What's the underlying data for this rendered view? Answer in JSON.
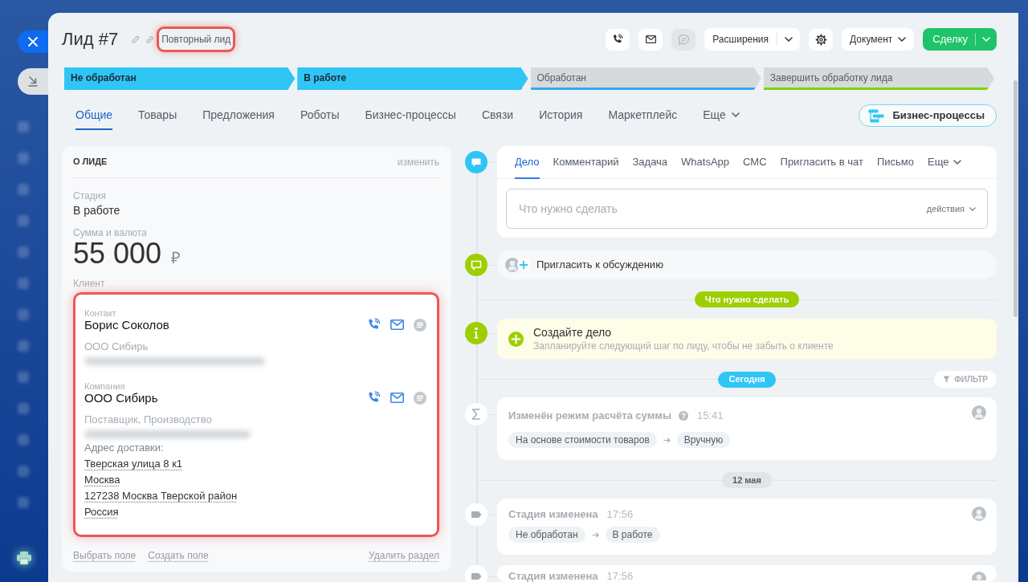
{
  "header": {
    "title": "Лид #7",
    "tag": {
      "label": "Повторный лид",
      "highlighted": true
    },
    "toolbar": [
      {
        "kind": "icon",
        "disabled": false
      },
      {
        "kind": "icon",
        "disabled": false
      },
      {
        "kind": "icon",
        "disabled": true
      },
      {
        "kind": "split",
        "label": "Расширения"
      },
      {
        "kind": "icon",
        "disabled": false
      },
      {
        "kind": "dropdown",
        "label": "Документ"
      },
      {
        "kind": "primary",
        "label": "Сделку"
      }
    ]
  },
  "stages": [
    {
      "label": "Не обработан",
      "reached": true,
      "color": "#2fc6f6"
    },
    {
      "label": "В работе",
      "reached": true,
      "color": "#2fc6f6"
    },
    {
      "label": "Обработан",
      "reached": false,
      "color": "#39a8ef"
    },
    {
      "label": "Завершить обработку лида",
      "reached": false,
      "color": "#7bd500"
    }
  ],
  "tabs": [
    {
      "label": "Общие",
      "selected": true,
      "dropdown": false
    },
    {
      "label": "Товары",
      "selected": false,
      "dropdown": false
    },
    {
      "label": "Предложения",
      "selected": false,
      "dropdown": false
    },
    {
      "label": "Роботы",
      "selected": false,
      "dropdown": false
    },
    {
      "label": "Бизнес-процессы",
      "selected": false,
      "dropdown": false
    },
    {
      "label": "Связи",
      "selected": false,
      "dropdown": false
    },
    {
      "label": "История",
      "selected": false,
      "dropdown": false
    },
    {
      "label": "Маркетплейс",
      "selected": false,
      "dropdown": false
    },
    {
      "label": "Еще",
      "selected": false,
      "dropdown": true
    }
  ],
  "process_button": {
    "label": "Бизнес-процессы"
  },
  "about": {
    "title": "О ЛИДЕ",
    "edit": "изменить",
    "fields": [
      {
        "kind": "text",
        "label": "Стадия",
        "value": "В работе"
      },
      {
        "kind": "money",
        "label": "Сумма и валюта",
        "value": "55 000",
        "currency": "₽"
      }
    ],
    "client": {
      "label": "Клиент",
      "highlighted": true,
      "entries": [
        {
          "type": "Контакт",
          "name": "Борис Соколов",
          "lines": [
            {
              "kind": "muted",
              "text": "ООО Сибирь"
            },
            {
              "kind": "redacted"
            }
          ]
        },
        {
          "type": "Компания",
          "name": "ООО Сибирь",
          "lines": [
            {
              "kind": "muted",
              "text": "Поставщик, Производство"
            },
            {
              "kind": "redacted"
            },
            {
              "kind": "label",
              "text": "Адрес доставки:"
            },
            {
              "kind": "address",
              "text": "Тверская улица 8 к1"
            },
            {
              "kind": "address",
              "text": "Москва"
            },
            {
              "kind": "address",
              "text": "127238 Москва Тверской район"
            },
            {
              "kind": "address",
              "text": "Россия"
            }
          ]
        }
      ]
    },
    "links": [
      "Выбрать поле",
      "Создать поле"
    ],
    "delete": "Удалить раздел"
  },
  "composer": {
    "tabs": [
      {
        "label": "Дело",
        "selected": true,
        "dropdown": false
      },
      {
        "label": "Комментарий",
        "selected": false,
        "dropdown": false
      },
      {
        "label": "Задача",
        "selected": false,
        "dropdown": false
      },
      {
        "label": "WhatsApp",
        "selected": false,
        "dropdown": false
      },
      {
        "label": "СМС",
        "selected": false,
        "dropdown": false
      },
      {
        "label": "Пригласить в чат",
        "selected": false,
        "dropdown": false
      },
      {
        "label": "Письмо",
        "selected": false,
        "dropdown": false
      },
      {
        "label": "Еще",
        "selected": false,
        "dropdown": true
      }
    ],
    "placeholder": "Что нужно сделать",
    "actions": "действия"
  },
  "invite": {
    "label": "Пригласить к обсуждению"
  },
  "timeline": [
    {
      "kind": "divider",
      "label": "Что нужно сделать",
      "color": "#9dcf00"
    },
    {
      "kind": "todo",
      "title": "Создайте дело",
      "text": "Запланируйте следующий шаг по лиду, чтобы не забыть о клиенте"
    },
    {
      "kind": "divider",
      "label": "Сегодня",
      "color": "#2fc6f6",
      "filter": "ФИЛЬТР"
    },
    {
      "kind": "sum_change",
      "title": "Изменён режим расчёта суммы",
      "help": true,
      "time": "15:41",
      "from": "На основе стоимости товаров",
      "to": "Вручную"
    },
    {
      "kind": "divider",
      "label": "12 мая",
      "color": "#dfe5e8"
    },
    {
      "kind": "stage_change",
      "title": "Стадия изменена",
      "time": "17:56",
      "from": "Не обработан",
      "to": "В работе"
    },
    {
      "kind": "stage_change",
      "title": "Стадия изменена",
      "time": "17:56"
    }
  ]
}
